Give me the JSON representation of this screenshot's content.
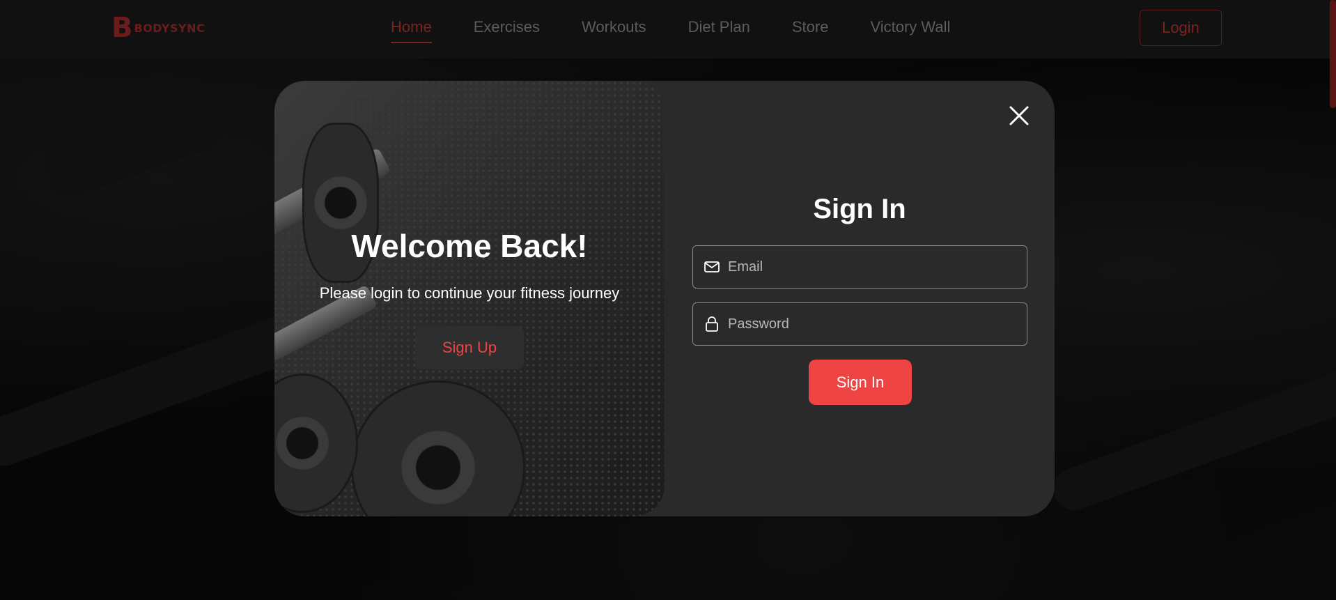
{
  "header": {
    "logo_mark": "B",
    "logo_text": "BODYSYNC",
    "nav": [
      {
        "label": "Home",
        "active": true
      },
      {
        "label": "Exercises",
        "active": false
      },
      {
        "label": "Workouts",
        "active": false
      },
      {
        "label": "Diet Plan",
        "active": false
      },
      {
        "label": "Store",
        "active": false
      },
      {
        "label": "Victory Wall",
        "active": false
      }
    ],
    "login_label": "Login"
  },
  "modal": {
    "welcome_title": "Welcome Back!",
    "welcome_subtitle": "Please login to continue your fitness journey",
    "signup_label": "Sign Up",
    "signin_title": "Sign In",
    "email_placeholder": "Email",
    "password_placeholder": "Password",
    "signin_label": "Sign In",
    "close_icon": "close-icon"
  },
  "colors": {
    "accent": "#ef4444",
    "modal_bg": "#2a2a2a",
    "nav_active": "#7a2420"
  }
}
